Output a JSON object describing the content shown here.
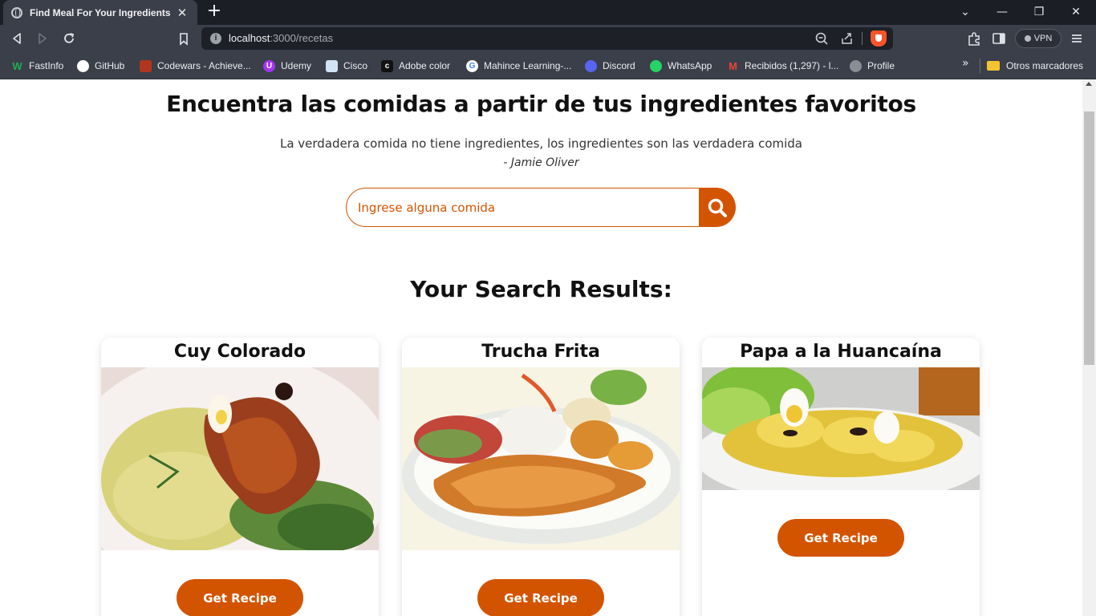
{
  "browser": {
    "tab_title": "Find Meal For Your Ingredients",
    "tab_close": "✕",
    "new_tab": "+",
    "url_host": "localhost",
    "url_path": ":3000/recetas",
    "vpn_label": "VPN",
    "bookmarks": [
      {
        "label": "FastInfo",
        "icon": "fastinfo-icon",
        "color": "#1fae51"
      },
      {
        "label": "GitHub",
        "icon": "github-icon",
        "color": "#ffffff"
      },
      {
        "label": "Codewars - Achieve...",
        "icon": "codewars-icon",
        "color": "#b1361e"
      },
      {
        "label": "Udemy",
        "icon": "udemy-icon",
        "color": "#a435f0"
      },
      {
        "label": "Cisco",
        "icon": "cisco-icon",
        "color": "#d0e4f5"
      },
      {
        "label": "Adobe color",
        "icon": "adobe-color-icon",
        "color": "#111111"
      },
      {
        "label": "Mahince Learning-...",
        "icon": "google-icon",
        "color": "#ffffff"
      },
      {
        "label": "Discord",
        "icon": "discord-icon",
        "color": "#5865f2"
      },
      {
        "label": "WhatsApp",
        "icon": "whatsapp-icon",
        "color": "#25d366"
      },
      {
        "label": "Recibidos (1,297) - l...",
        "icon": "gmail-icon",
        "color": "#ea4335"
      },
      {
        "label": "Profile",
        "icon": "globe-icon",
        "color": "#8a8d94"
      }
    ],
    "other_bookmarks": "Otros marcadores"
  },
  "page": {
    "title": "Encuentra las comidas a partir de tus ingredientes favoritos",
    "quote": "La verdadera comida no tiene ingredientes, los ingredientes son las verdadera comida",
    "author": "- Jamie Oliver",
    "search_placeholder": "Ingrese alguna comida",
    "results_title": "Your Search Results:",
    "accent_color": "#d35400",
    "meals": [
      {
        "name": "Cuy Colorado",
        "button": "Get Recipe"
      },
      {
        "name": "Trucha Frita",
        "button": "Get Recipe"
      },
      {
        "name": "Papa a la Huancaína",
        "button": "Get Recipe"
      }
    ]
  }
}
